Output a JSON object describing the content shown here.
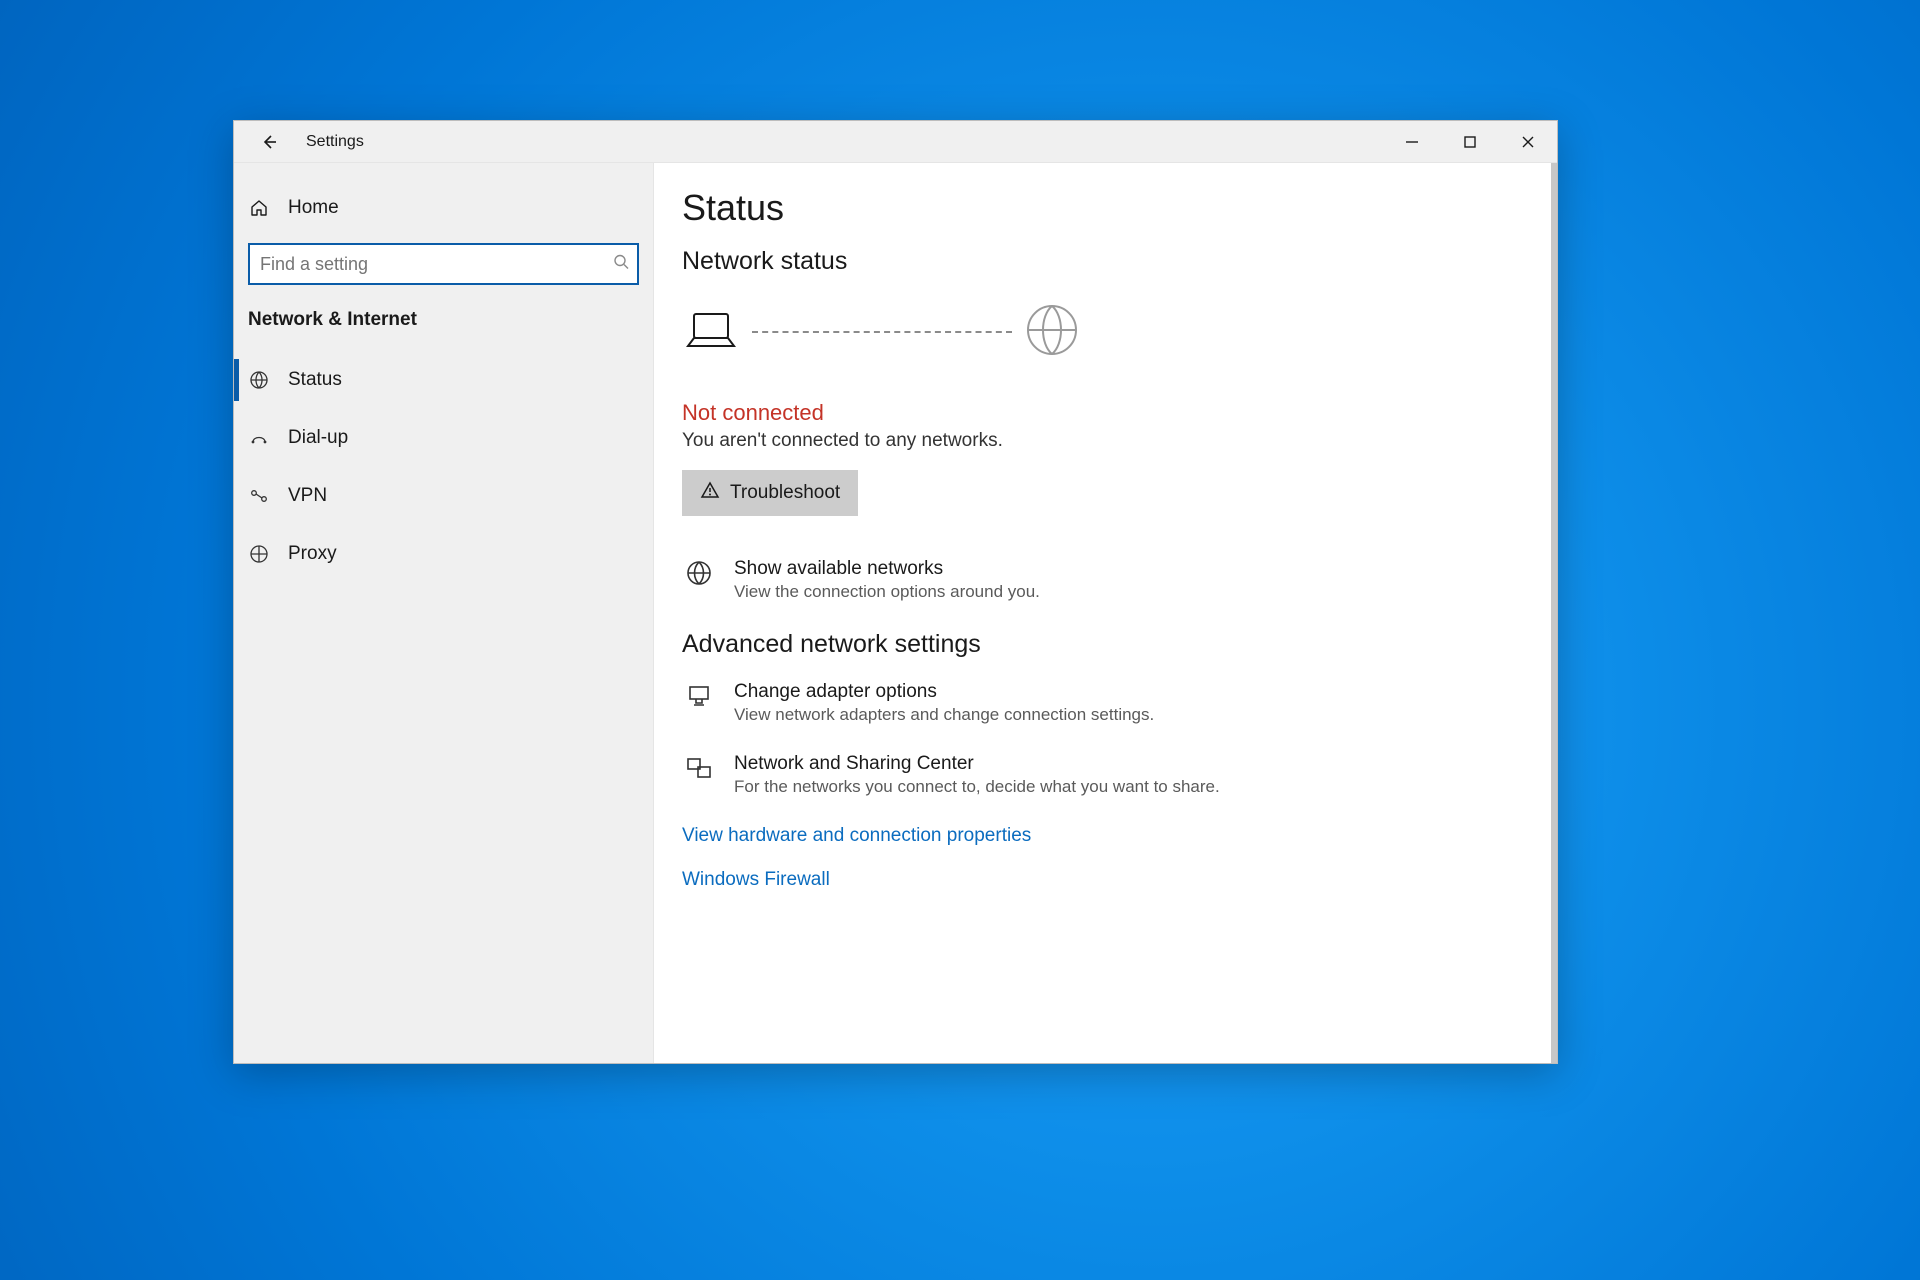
{
  "window": {
    "title": "Settings"
  },
  "sidebar": {
    "home": "Home",
    "search_placeholder": "Find a setting",
    "section": "Network & Internet",
    "items": [
      {
        "label": "Status",
        "active": true
      },
      {
        "label": "Dial-up",
        "active": false
      },
      {
        "label": "VPN",
        "active": false
      },
      {
        "label": "Proxy",
        "active": false
      }
    ]
  },
  "page": {
    "title": "Status",
    "section1": "Network status",
    "not_connected": "Not connected",
    "not_connected_desc": "You aren't connected to any networks.",
    "troubleshoot": "Troubleshoot",
    "show_networks": {
      "title": "Show available networks",
      "desc": "View the connection options around you."
    },
    "section2": "Advanced network settings",
    "adapter": {
      "title": "Change adapter options",
      "desc": "View network adapters and change connection settings."
    },
    "sharing": {
      "title": "Network and Sharing Center",
      "desc": "For the networks you connect to, decide what you want to share."
    },
    "link_hw": "View hardware and connection properties",
    "link_fw": "Windows Firewall"
  }
}
